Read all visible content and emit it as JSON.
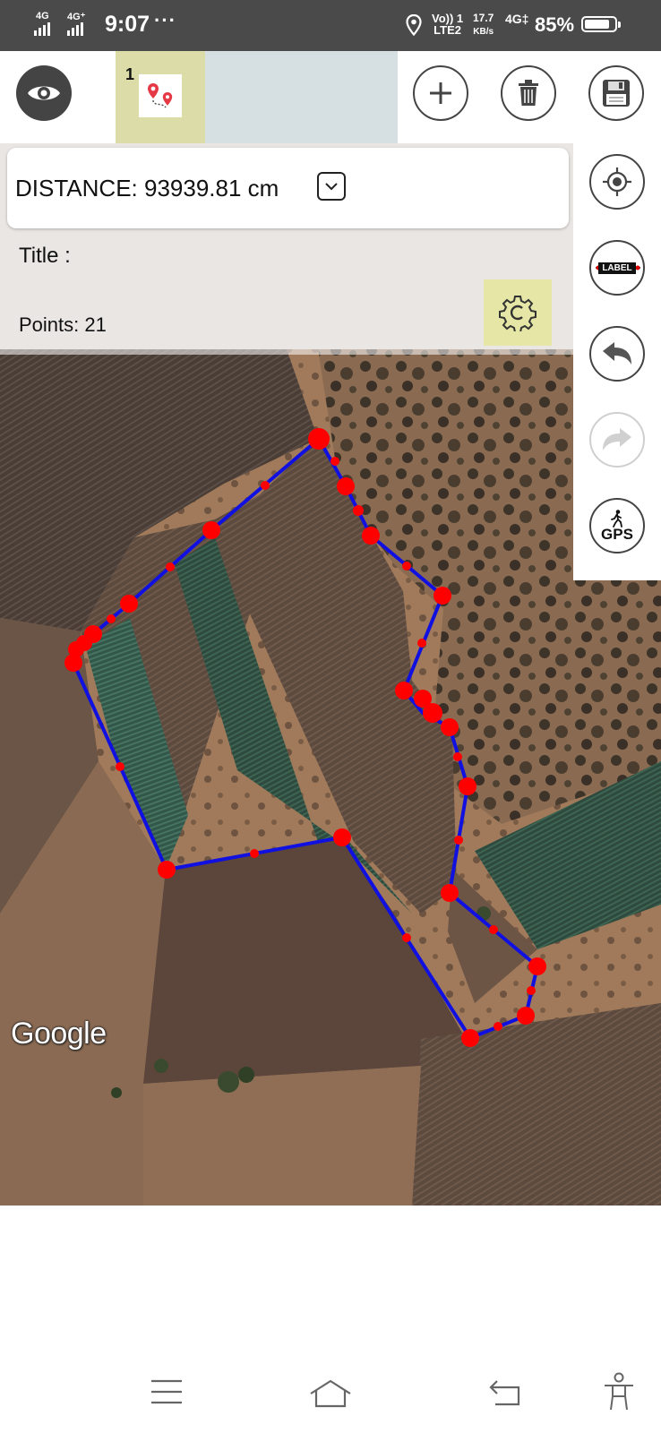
{
  "status_bar": {
    "network_left": "4G",
    "network_right": "4G⁺",
    "time": "9:07",
    "overflow_dots": "···",
    "volte_line1": "Vo)) 1",
    "volte_line2": "LTE2",
    "speed_value": "17.7",
    "speed_unit": "KB/s",
    "network_type": "4G‡",
    "battery_percent": "85%",
    "battery_level": 0.85
  },
  "toolbar": {
    "tab_number": "1",
    "eye_icon": "eye-icon",
    "tab_icon": "route-pin-icon",
    "add_icon": "plus-icon",
    "delete_icon": "trash-icon",
    "save_icon": "floppy-disk-icon"
  },
  "info": {
    "distance_label": "DISTANCE: 93939.81 cm",
    "title_label": "Title :",
    "points_label": "Points: 21",
    "dropdown_icon": "chevron-down-icon",
    "settings_icon": "gear-icon"
  },
  "side_controls": {
    "locate_icon": "crosshair-icon",
    "label_text": "LABEL",
    "undo_icon": "undo-icon",
    "redo_icon": "redo-icon",
    "gps_text": "GPS"
  },
  "map": {
    "attribution": "Google",
    "route_color": "#1010e0",
    "point_color": "#ff0000"
  },
  "nav_bar": {
    "menu_icon": "menu-icon",
    "home_icon": "home-icon",
    "back_icon": "back-icon",
    "accessibility_icon": "accessibility-icon"
  }
}
